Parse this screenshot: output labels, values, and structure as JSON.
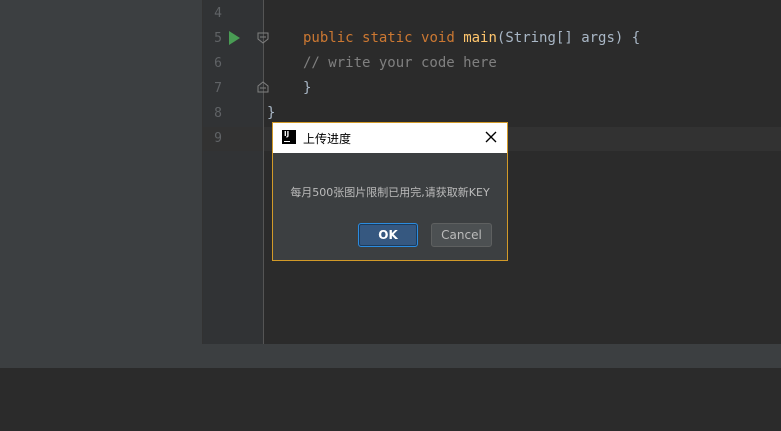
{
  "editor": {
    "line_numbers": [
      "4",
      "5",
      "6",
      "7",
      "8",
      "9"
    ],
    "line5": {
      "kw_public": "public",
      "kw_static": "static",
      "kw_void": "void",
      "method": "main",
      "rest": "(String[] args) {"
    },
    "line6": "// write your code here",
    "line7": "}",
    "line8": "}"
  },
  "dialog": {
    "title": "上传进度",
    "message": "每月500张图片限制已用完,请获取新KEY",
    "ok_label": "OK",
    "cancel_label": "Cancel"
  },
  "colors": {
    "keyword": "#cc7832",
    "method": "#ffc66d",
    "comment": "#808080",
    "dialog_border": "#d29a28",
    "run_icon": "#499c54"
  },
  "icons": {
    "run": "run-gutter-icon",
    "fold": "fold-marker-icon",
    "app": "intellij-logo-icon",
    "close": "close-icon"
  }
}
